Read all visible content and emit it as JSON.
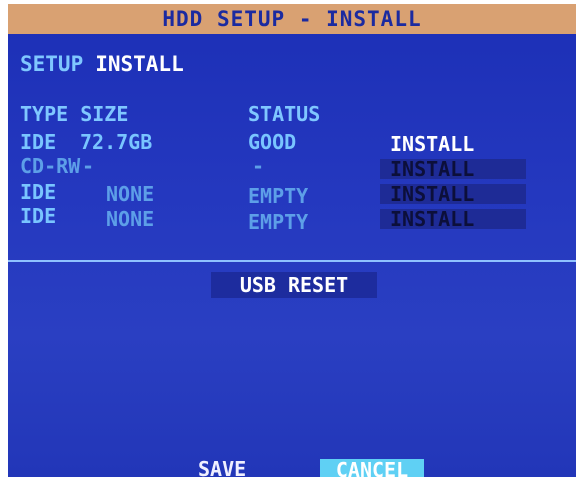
{
  "title": "HDD SETUP - INSTALL",
  "tabs": {
    "setup": "SETUP",
    "install": "INSTALL"
  },
  "headers": {
    "type_size": "TYPE SIZE",
    "status": "STATUS"
  },
  "rows": [
    {
      "type": "IDE",
      "size": "72.7GB",
      "status": "GOOD",
      "action": "INSTALL"
    },
    {
      "type": "CD-RW",
      "size": "-",
      "status": "-",
      "action": "INSTALL"
    },
    {
      "type": "IDE",
      "size": "NONE",
      "status": "EMPTY",
      "action": "INSTALL"
    },
    {
      "type": "IDE",
      "size": "NONE",
      "status": "EMPTY",
      "action": "INSTALL"
    }
  ],
  "usb_reset": "USB RESET",
  "save": "SAVE",
  "cancel": "CANCEL",
  "colors": {
    "screen_blue": "#2438bf",
    "title_bar": "#d9a172",
    "cyan_text": "#79c5ff",
    "cancel_highlight": "#5fd0f4"
  }
}
